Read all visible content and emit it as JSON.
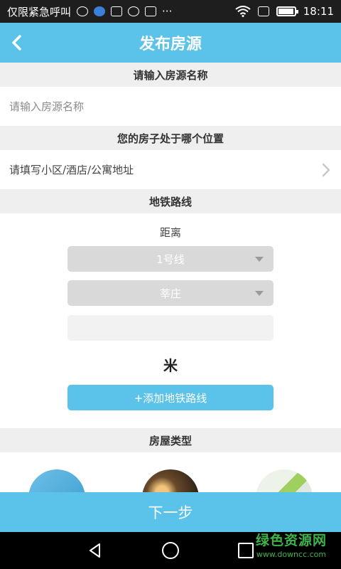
{
  "status_bar": {
    "carrier": "仅限紧急呼叫",
    "more": "···",
    "time": "18:11"
  },
  "header": {
    "title": "发布房源",
    "back_icon": "chevron-left-icon"
  },
  "sections": {
    "name": {
      "header": "请输入房源名称",
      "placeholder": "请输入房源名称",
      "value": ""
    },
    "location": {
      "header": "您的房子处于哪个位置",
      "value": "请填写小区/酒店/公寓地址"
    },
    "subway": {
      "header": "地铁路线",
      "distance_label": "距离",
      "line_select": "1号线",
      "station_select": "莘庄",
      "distance_value": "",
      "unit": "米",
      "add_button": "+添加地铁路线"
    },
    "house_type": {
      "header": "房屋类型"
    }
  },
  "footer": {
    "next_button": "下一步"
  },
  "watermark": {
    "title": "绿色资源网",
    "url": "www.downcc.com"
  },
  "colors": {
    "accent": "#5bc2ea",
    "section_bg": "#efefef",
    "select_bg": "#d9d9d9",
    "watermark": "#3db34a"
  }
}
